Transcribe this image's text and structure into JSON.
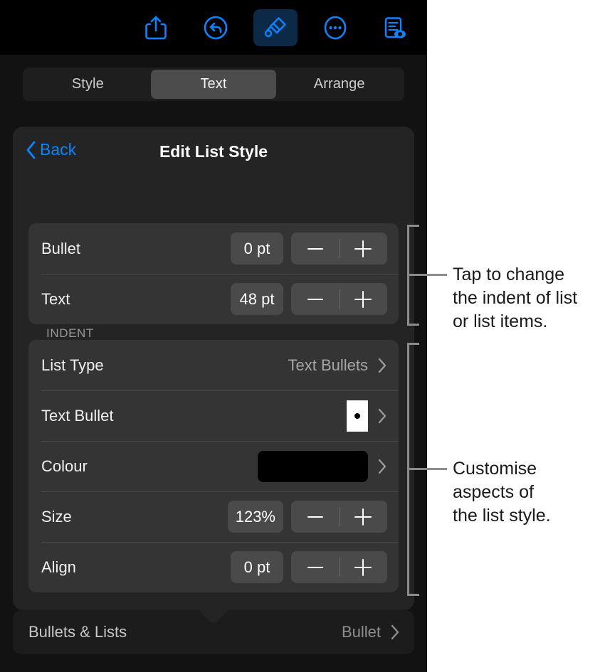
{
  "toolbar": {
    "buttons": [
      {
        "name": "share",
        "label": "Share",
        "selected": false
      },
      {
        "name": "undo",
        "label": "Undo",
        "selected": false
      },
      {
        "name": "format-brush",
        "label": "Format",
        "selected": true
      },
      {
        "name": "more",
        "label": "More",
        "selected": false
      },
      {
        "name": "document-view",
        "label": "Document Options",
        "selected": false
      }
    ],
    "accent_colour": "#0a84ff",
    "selected_background": "#0c2a47"
  },
  "segmented": {
    "tabs": [
      {
        "label": "Style",
        "active": false
      },
      {
        "label": "Text",
        "active": true
      },
      {
        "label": "Arrange",
        "active": false
      }
    ]
  },
  "popover": {
    "back_label": "Back",
    "title": "Edit List Style",
    "section_label": "INDENT",
    "indent_rows": [
      {
        "label": "Bullet",
        "value": "0 pt"
      },
      {
        "label": "Text",
        "value": "48 pt"
      }
    ],
    "list_rows": [
      {
        "label": "List Type",
        "value": "Text Bullets",
        "control": "disclosure"
      },
      {
        "label": "Text Bullet",
        "value": "",
        "control": "bullet-swatch"
      },
      {
        "label": "Colour",
        "value": "",
        "control": "colour-swatch",
        "colour": "#000000"
      },
      {
        "label": "Size",
        "value": "123%",
        "control": "stepper"
      },
      {
        "label": "Align",
        "value": "0 pt",
        "control": "stepper"
      }
    ]
  },
  "bottom_bar": {
    "label": "Bullets & Lists",
    "value": "Bullet"
  },
  "annotations": [
    {
      "text": "Tap to change\nthe indent of list\nor list items."
    },
    {
      "text": "Customise\naspects of\nthe list style."
    }
  ]
}
